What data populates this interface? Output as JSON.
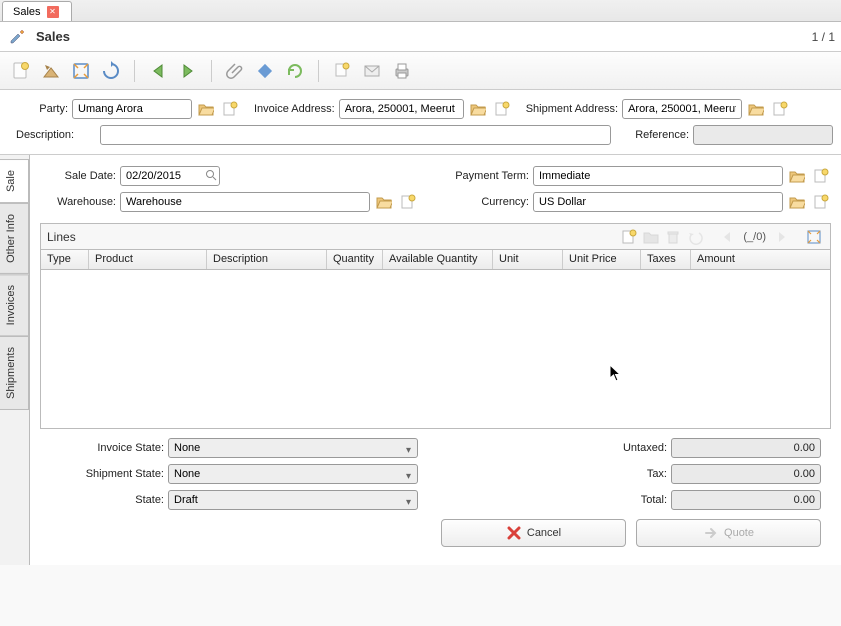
{
  "tab": {
    "label": "Sales"
  },
  "title": {
    "text": "Sales",
    "pager": "1 / 1"
  },
  "form": {
    "party_label": "Party:",
    "party_value": "Umang Arora",
    "invoice_addr_label": "Invoice Address:",
    "invoice_addr_value": "Arora, 250001, Meerut",
    "shipment_addr_label": "Shipment Address:",
    "shipment_addr_value": "Arora, 250001, Meerut",
    "description_label": "Description:",
    "description_value": "",
    "reference_label": "Reference:",
    "reference_value": "",
    "sale_date_label": "Sale Date:",
    "sale_date_value": "02/20/2015",
    "payment_term_label": "Payment Term:",
    "payment_term_value": "Immediate",
    "warehouse_label": "Warehouse:",
    "warehouse_value": "Warehouse",
    "currency_label": "Currency:",
    "currency_value": "US Dollar"
  },
  "side_tabs": {
    "sale": "Sale",
    "other_info": "Other Info",
    "invoices": "Invoices",
    "shipments": "Shipments"
  },
  "lines": {
    "title": "Lines",
    "nav": "(_/0)",
    "columns": {
      "type": "Type",
      "product": "Product",
      "description": "Description",
      "quantity": "Quantity",
      "avail_qty": "Available Quantity",
      "unit": "Unit",
      "unit_price": "Unit Price",
      "taxes": "Taxes",
      "amount": "Amount"
    }
  },
  "states": {
    "invoice_state_label": "Invoice State:",
    "invoice_state_value": "None",
    "shipment_state_label": "Shipment State:",
    "shipment_state_value": "None",
    "state_label": "State:",
    "state_value": "Draft"
  },
  "totals": {
    "untaxed_label": "Untaxed:",
    "untaxed_value": "0.00",
    "tax_label": "Tax:",
    "tax_value": "0.00",
    "total_label": "Total:",
    "total_value": "0.00"
  },
  "actions": {
    "cancel": "Cancel",
    "quote": "Quote"
  }
}
